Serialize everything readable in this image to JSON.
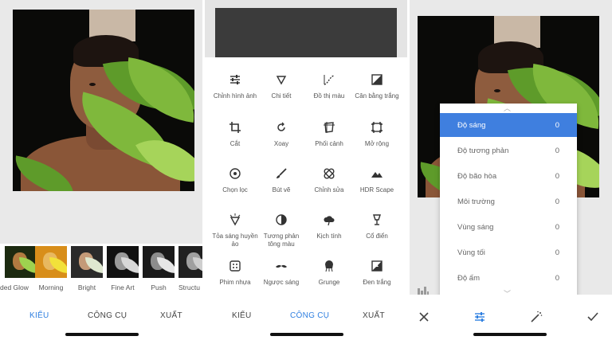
{
  "screen1": {
    "filters": [
      {
        "label": "ded Glow"
      },
      {
        "label": "Morning"
      },
      {
        "label": "Bright"
      },
      {
        "label": "Fine Art"
      },
      {
        "label": "Push"
      },
      {
        "label": "Structu"
      }
    ],
    "tabs": {
      "kieu": "KIỂU",
      "cong_cu": "CÔNG CỤ",
      "xuat": "XUẤT"
    },
    "active_tab": "KIỂU"
  },
  "screen2": {
    "tools": [
      {
        "label": "Chỉnh hình ảnh",
        "icon": "tune-sliders-icon"
      },
      {
        "label": "Chi tiết",
        "icon": "triangle-details-icon"
      },
      {
        "label": "Đồ thị màu",
        "icon": "curves-icon"
      },
      {
        "label": "Cân bằng trắng",
        "icon": "white-balance-icon"
      },
      {
        "label": "Cắt",
        "icon": "crop-icon"
      },
      {
        "label": "Xoay",
        "icon": "rotate-icon"
      },
      {
        "label": "Phối cảnh",
        "icon": "perspective-icon"
      },
      {
        "label": "Mở rộng",
        "icon": "expand-icon"
      },
      {
        "label": "Chọn lọc",
        "icon": "selective-icon"
      },
      {
        "label": "Bút vẽ",
        "icon": "brush-icon"
      },
      {
        "label": "Chỉnh sửa",
        "icon": "healing-icon"
      },
      {
        "label": "HDR Scape",
        "icon": "mountains-icon"
      },
      {
        "label": "Tỏa sáng huyền ảo",
        "icon": "glamour-glow-icon"
      },
      {
        "label": "Tương phản tông màu",
        "icon": "tonal-contrast-icon"
      },
      {
        "label": "Kịch tính",
        "icon": "drama-cloud-icon"
      },
      {
        "label": "Cổ điển",
        "icon": "vintage-lamp-icon"
      },
      {
        "label": "Phim nhựa",
        "icon": "grainy-film-icon"
      },
      {
        "label": "Ngược sáng",
        "icon": "mustache-icon"
      },
      {
        "label": "Grunge",
        "icon": "grunge-icon"
      },
      {
        "label": "Đen trắng",
        "icon": "black-white-icon"
      }
    ],
    "tabs": {
      "kieu": "KIỂU",
      "cong_cu": "CÔNG CỤ",
      "xuat": "XUẤT"
    },
    "active_tab": "CÔNG CỤ"
  },
  "screen3": {
    "adjustments": [
      {
        "name": "Độ sáng",
        "value": "0",
        "selected": true
      },
      {
        "name": "Độ tương phản",
        "value": "0",
        "selected": false
      },
      {
        "name": "Độ bão hòa",
        "value": "0",
        "selected": false
      },
      {
        "name": "Môi trường",
        "value": "0",
        "selected": false
      },
      {
        "name": "Vùng sáng",
        "value": "0",
        "selected": false
      },
      {
        "name": "Vùng tối",
        "value": "0",
        "selected": false
      },
      {
        "name": "Độ ấm",
        "value": "0",
        "selected": false
      }
    ],
    "bottom_icons": [
      "close-icon",
      "tune-sliders-icon",
      "magic-wand-icon",
      "checkmark-icon"
    ]
  },
  "colors": {
    "accent": "#2f7fe0",
    "selected_row": "#3f7fdf",
    "leaf_green": "#7fb83c",
    "background_gray": "#e9e9e9"
  }
}
